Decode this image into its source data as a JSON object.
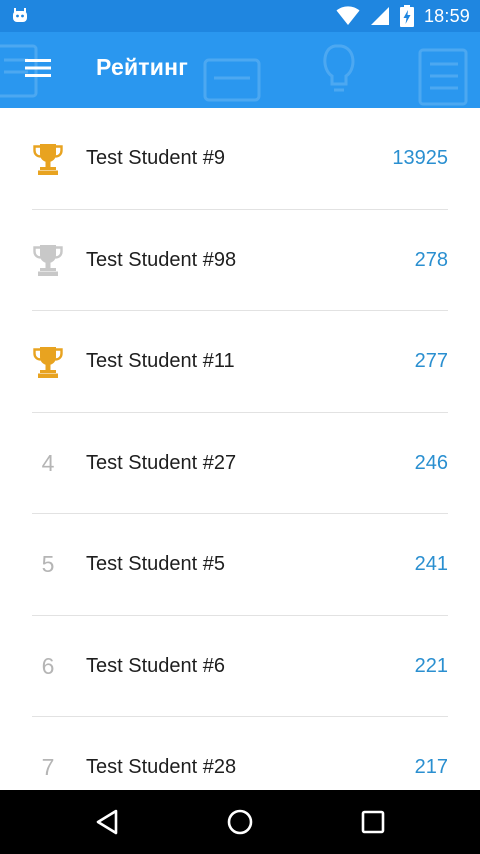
{
  "status_bar": {
    "time": "18:59",
    "icons": [
      "app-notification-icon",
      "wifi-icon",
      "signal-icon",
      "battery-charging-icon"
    ]
  },
  "app_bar": {
    "title": "Рейтинг",
    "menu_icon": "hamburger-menu-icon"
  },
  "colors": {
    "status_bar": "#1f86e0",
    "app_bar": "#2a97ef",
    "score": "#2a8fd0",
    "gold": "#e8a320",
    "silver": "#c8c8c8",
    "rank_number": "#b5b5b5"
  },
  "leaderboard": [
    {
      "rank": "1",
      "trophy": "gold",
      "name": "Test Student #9",
      "score": "13925"
    },
    {
      "rank": "2",
      "trophy": "silver",
      "name": "Test Student #98",
      "score": "278"
    },
    {
      "rank": "3",
      "trophy": "gold",
      "name": "Test Student #11",
      "score": "277"
    },
    {
      "rank": "4",
      "trophy": "",
      "name": "Test Student #27",
      "score": "246"
    },
    {
      "rank": "5",
      "trophy": "",
      "name": "Test Student #5",
      "score": "241"
    },
    {
      "rank": "6",
      "trophy": "",
      "name": "Test Student #6",
      "score": "221"
    },
    {
      "rank": "7",
      "trophy": "",
      "name": "Test Student #28",
      "score": "217"
    }
  ],
  "nav_bar": {
    "icons": [
      "back-icon",
      "home-icon",
      "recent-apps-icon"
    ]
  }
}
